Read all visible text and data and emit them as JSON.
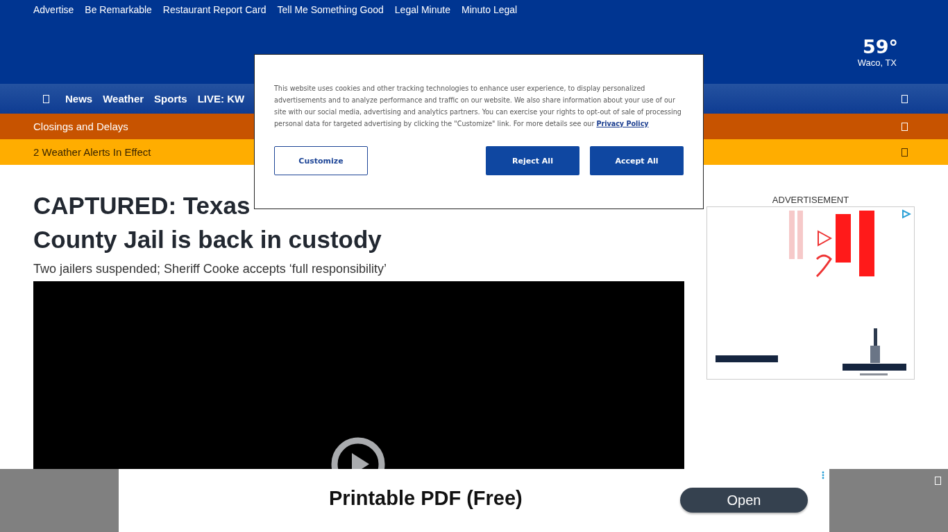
{
  "top_links": [
    "Advertise",
    "Be Remarkable",
    "Restaurant Report Card",
    "Tell Me Something Good",
    "Legal Minute",
    "Minuto Legal"
  ],
  "weather": {
    "temperature": "59°",
    "location": "Waco, TX"
  },
  "nav": {
    "items": [
      "News",
      "Weather",
      "Sports",
      "LIVE: KW"
    ]
  },
  "banners": [
    {
      "kind": "closings",
      "label": "Closings and Delays",
      "color": "#c75300"
    },
    {
      "kind": "alerts",
      "label": "2 Weather Alerts In Effect",
      "color": "#ffad00"
    }
  ],
  "article": {
    "headline_lines": [
      "CAPTURED: Texas",
      "County Jail is back in custody"
    ],
    "subheadline": "Two jailers suspended; Sheriff Cooke accepts ‘full responsibility’"
  },
  "sidebar_ad": {
    "label": "ADVERTISEMENT",
    "kind": "picture"
  },
  "cookie_dialog": {
    "text": "This website uses cookies and other tracking technologies to enhance user experience, to display personalized advertisements and to analyze performance and traffic on our website. We also share information about your use of our site with our social media, advertising and analytics partners. You can exercise your rights to opt-out of sale of processing personal data for targeted advertising by clicking the \"Customize\" link. For more details see our",
    "link": "Privacy Policy",
    "buttons": [
      {
        "kind": "outline",
        "label": "Customize"
      },
      {
        "kind": "filled",
        "label": "Reject All"
      },
      {
        "kind": "filled",
        "label": "Accept All"
      }
    ]
  },
  "bottom_ad": {
    "title": "Printable PDF (Free)",
    "button": "Open"
  }
}
